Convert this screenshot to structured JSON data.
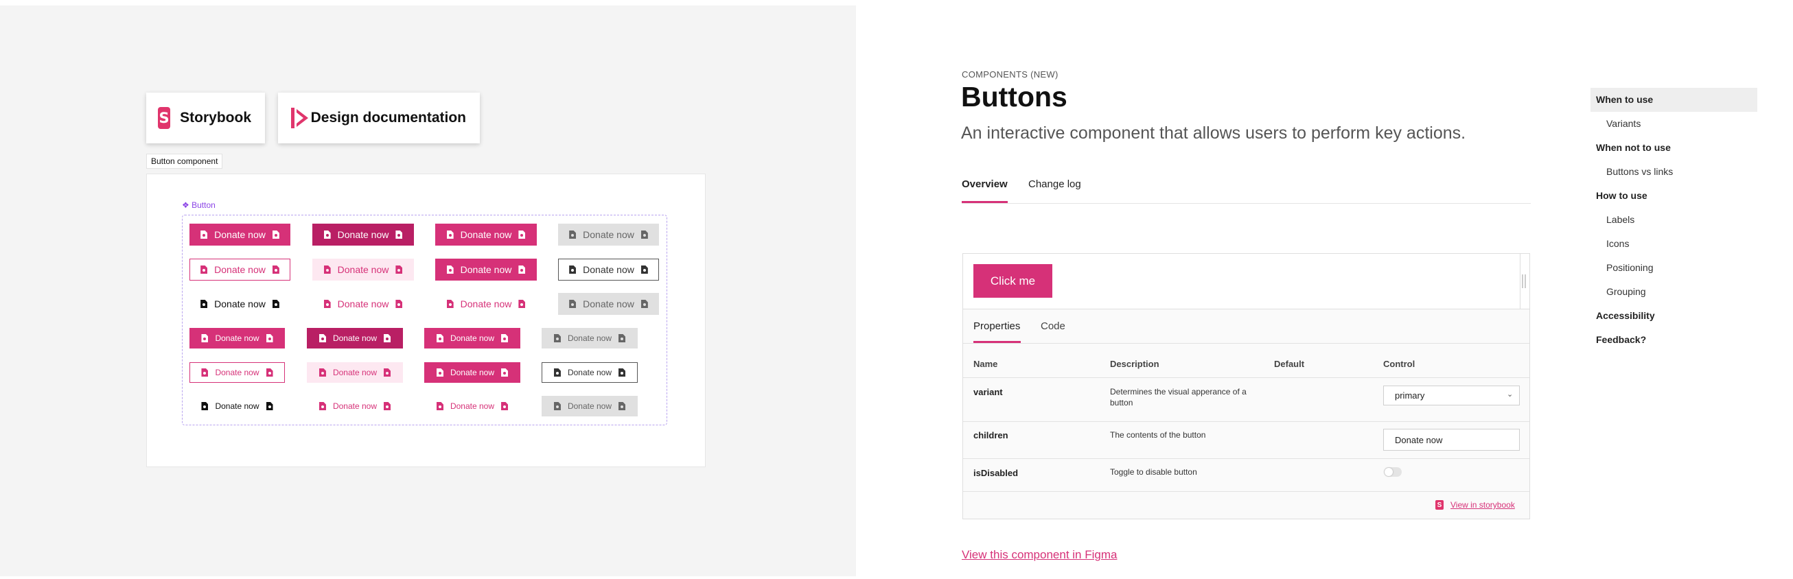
{
  "canvas": {
    "chips": {
      "storybook": {
        "logo_letter": "S",
        "label": "Storybook"
      },
      "design": {
        "label": "Design documentation"
      }
    },
    "frame_label": "Button component",
    "component_label": "❖ Button",
    "button_label": "Donate now"
  },
  "doc": {
    "eyebrow": "COMPONENTS (NEW)",
    "title": "Buttons",
    "subtitle": "An interactive component that allows users to perform key actions.",
    "tabs": [
      {
        "label": "Overview",
        "active": true
      },
      {
        "label": "Change log",
        "active": false
      }
    ],
    "preview": {
      "button_label": "Click me"
    },
    "props": {
      "tabs": [
        {
          "label": "Properties",
          "active": true
        },
        {
          "label": "Code",
          "active": false
        }
      ],
      "headers": {
        "name": "Name",
        "description": "Description",
        "default": "Default",
        "control": "Control"
      },
      "rows": [
        {
          "name": "variant",
          "description": "Determines the visual apperance of a button",
          "control_value": "primary"
        },
        {
          "name": "children",
          "description": "The contents of the button",
          "control_value": "Donate now"
        },
        {
          "name": "isDisabled",
          "description": "Toggle to disable button",
          "control_value": false
        }
      ],
      "storybook_logo_letter": "S",
      "storybook_link": "View in storybook"
    },
    "figma_link": "View this component in Figma"
  },
  "toc": {
    "items": [
      {
        "label": "When to use",
        "level": 1,
        "active": true
      },
      {
        "label": "Variants",
        "level": 2
      },
      {
        "label": "When not to use",
        "level": 1
      },
      {
        "label": "Buttons vs links",
        "level": 2
      },
      {
        "label": "How to use",
        "level": 1
      },
      {
        "label": "Labels",
        "level": 2
      },
      {
        "label": "Icons",
        "level": 2
      },
      {
        "label": "Positioning",
        "level": 2
      },
      {
        "label": "Grouping",
        "level": 2
      },
      {
        "label": "Accessibility",
        "level": 1
      },
      {
        "label": "Feedback?",
        "level": 1
      }
    ]
  },
  "colors": {
    "accent": "#d63178",
    "accent_dark": "#b91f64",
    "canvas_bg": "#f4f4f4",
    "component_purple": "#8b44e6"
  },
  "icons": {
    "chip_storybook": "storybook-logo-icon",
    "chip_design": "design-docs-logo-icon",
    "button_icon": "document-icon",
    "select_chevron": "chevron-down-icon"
  }
}
